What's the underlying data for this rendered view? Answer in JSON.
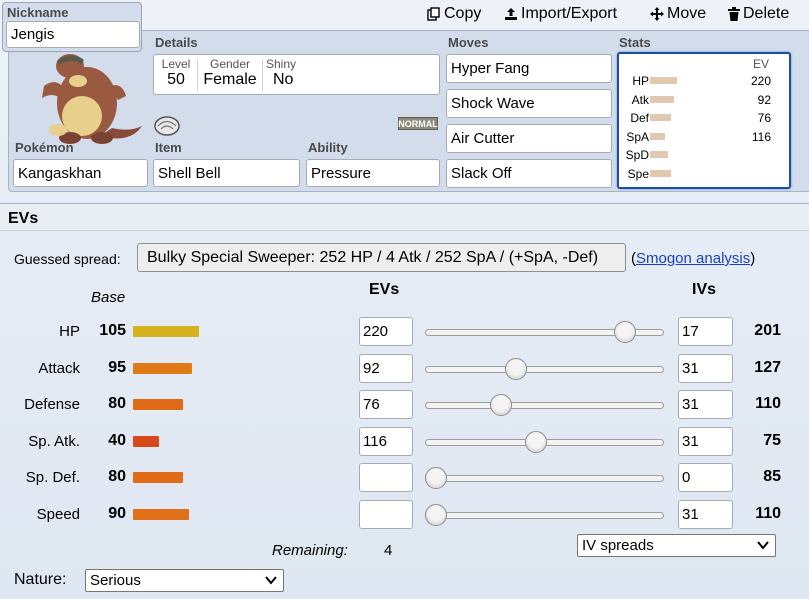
{
  "toolbar": {
    "copy_label": "Copy",
    "import_export_label": "Import/Export",
    "move_label": "Move",
    "delete_label": "Delete"
  },
  "nickname": {
    "label": "Nickname",
    "value": "Jengis"
  },
  "details": {
    "label": "Details",
    "level_label": "Level",
    "level_value": "50",
    "gender_label": "Gender",
    "gender_value": "Female",
    "shiny_label": "Shiny",
    "shiny_value": "No"
  },
  "type_badge": "NORMAL",
  "pokemon": {
    "label": "Pokémon",
    "value": "Kangaskhan"
  },
  "item": {
    "label": "Item",
    "value": "Shell Bell"
  },
  "ability": {
    "label": "Ability",
    "value": "Pressure"
  },
  "moves": {
    "label": "Moves",
    "list": [
      "Hyper Fang",
      "Shock Wave",
      "Air Cutter",
      "Slack Off"
    ]
  },
  "stats_panel": {
    "label": "Stats",
    "ev_header": "EV",
    "rows": [
      {
        "label": "HP",
        "ev": "220",
        "bar_fraction": 0.78
      },
      {
        "label": "Atk",
        "ev": "92",
        "bar_fraction": 0.72
      },
      {
        "label": "Def",
        "ev": "76",
        "bar_fraction": 0.62
      },
      {
        "label": "SpA",
        "ev": "116",
        "bar_fraction": 0.45
      },
      {
        "label": "SpD",
        "ev": "",
        "bar_fraction": 0.52
      },
      {
        "label": "Spe",
        "ev": "",
        "bar_fraction": 0.62
      }
    ]
  },
  "evs": {
    "title": "EVs",
    "guessed_label": "Guessed spread:",
    "guessed_value": "Bulky Special Sweeper: 252 HP / 4 Atk / 252 SpA / (+SpA, -Def)",
    "paren_open": "(",
    "smogon_link": "Smogon analysis",
    "paren_close": ")",
    "base_header": "Base",
    "evs_header": "EVs",
    "ivs_header": "IVs",
    "rows": [
      {
        "name": "HP",
        "base": "105",
        "bar_color": "#d4b31e",
        "base_fraction": 0.41,
        "ev": "220",
        "slider_fraction": 0.87,
        "iv": "17",
        "total": "201"
      },
      {
        "name": "Attack",
        "base": "95",
        "bar_color": "#e07a18",
        "base_fraction": 0.37,
        "ev": "92",
        "slider_fraction": 0.37,
        "iv": "31",
        "total": "127"
      },
      {
        "name": "Defense",
        "base": "80",
        "bar_color": "#e06a18",
        "base_fraction": 0.31,
        "ev": "76",
        "slider_fraction": 0.3,
        "iv": "31",
        "total": "110"
      },
      {
        "name": "Sp. Atk.",
        "base": "40",
        "bar_color": "#d9481b",
        "base_fraction": 0.16,
        "ev": "116",
        "slider_fraction": 0.46,
        "iv": "31",
        "total": "75"
      },
      {
        "name": "Sp. Def.",
        "base": "80",
        "bar_color": "#e06a18",
        "base_fraction": 0.31,
        "ev": "",
        "slider_fraction": 0.0,
        "iv": "0",
        "total": "85"
      },
      {
        "name": "Speed",
        "base": "90",
        "bar_color": "#e0701a",
        "base_fraction": 0.35,
        "ev": "",
        "slider_fraction": 0.0,
        "iv": "31",
        "total": "110"
      }
    ],
    "remaining_label": "Remaining:",
    "remaining_value": "4",
    "iv_spreads_select": "IV spreads",
    "nature_label": "Nature:",
    "nature_value": "Serious"
  },
  "icons": [
    "copy-icon",
    "import-export-icon",
    "move-icon",
    "trash-icon",
    "chevron-down-icon",
    "shell-bell-item-icon",
    "pokemon-sprite"
  ]
}
